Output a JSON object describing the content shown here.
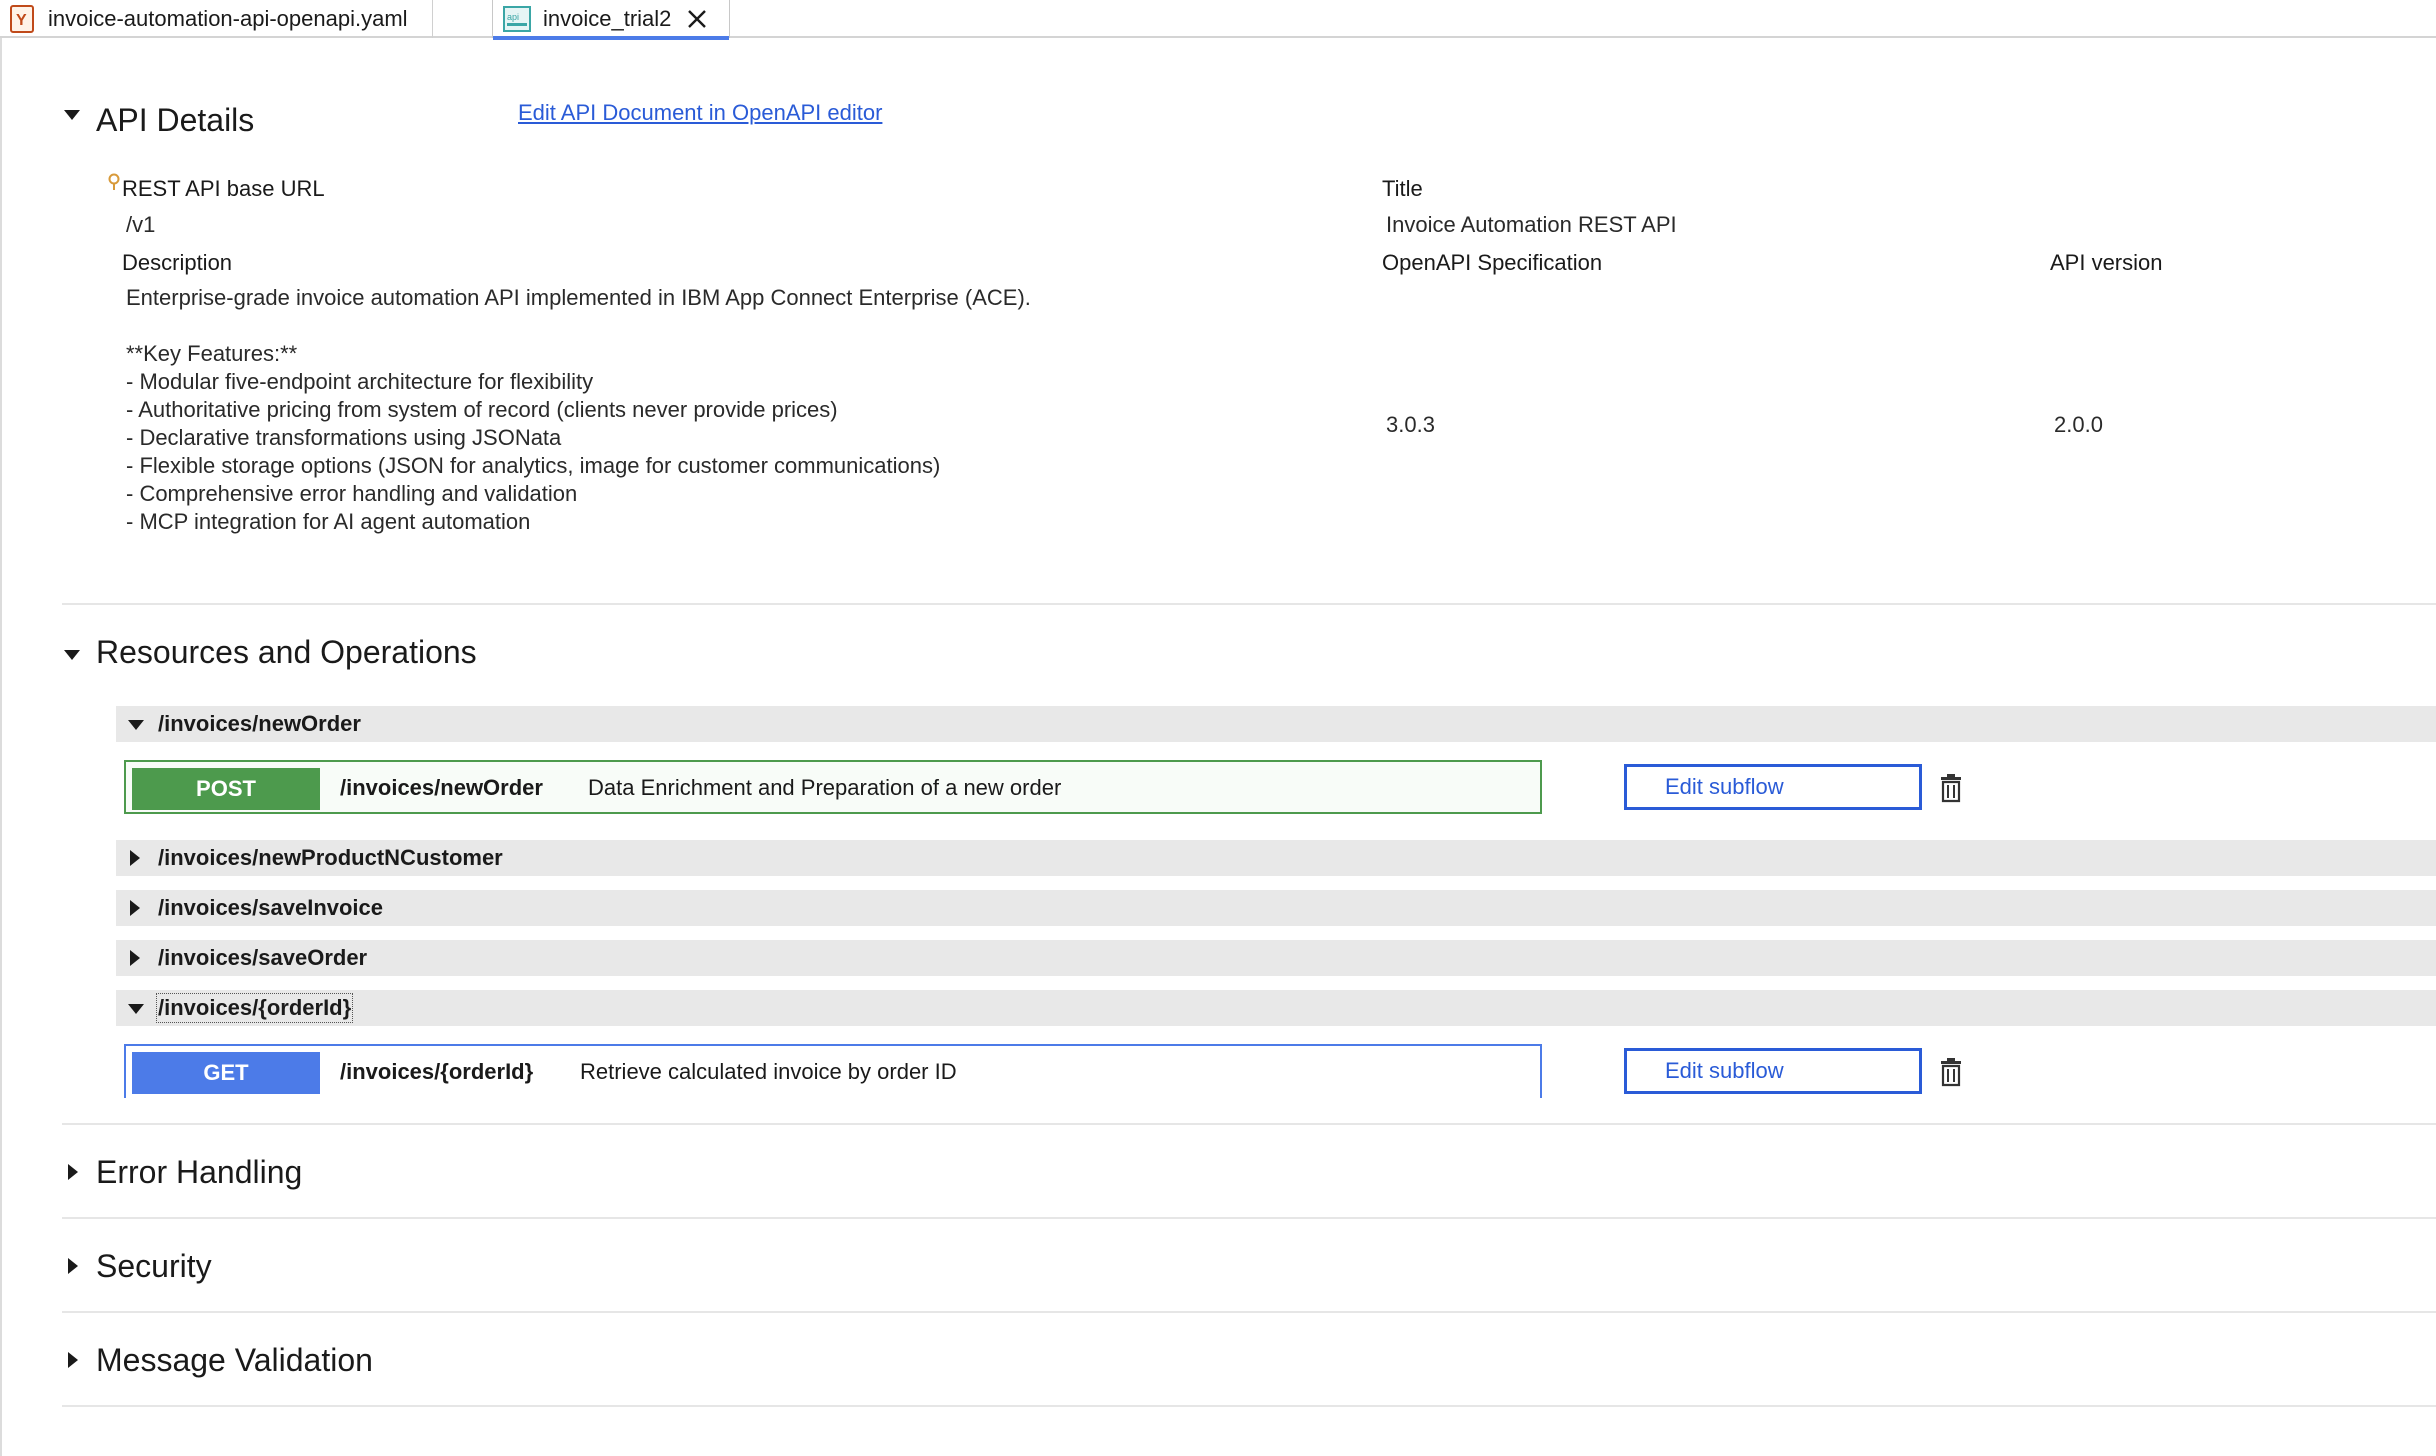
{
  "tabs": [
    {
      "label": "invoice-automation-api-openapi.yaml",
      "icon": "yaml-file-icon"
    },
    {
      "label": "invoice_trial2",
      "icon": "api-file-icon",
      "active": true
    }
  ],
  "api_details": {
    "section_title": "API Details",
    "edit_link": "Edit API Document in OpenAPI editor",
    "base_url_label": "REST API base URL",
    "base_url_value": "/v1",
    "title_label": "Title",
    "title_value": "Invoice Automation REST API",
    "description_label": "Description",
    "description_value": "Enterprise-grade invoice automation API implemented in IBM App Connect Enterprise (ACE).\n\n**Key Features:**\n- Modular five-endpoint architecture for flexibility\n- Authoritative pricing from system of record (clients never provide prices)\n- Declarative transformations using JSONata\n- Flexible storage options (JSON for analytics, image for customer communications)\n- Comprehensive error handling and validation\n- MCP integration for AI agent automation",
    "openapi_label": "OpenAPI Specification",
    "openapi_value": "3.0.3",
    "version_label": "API version",
    "version_value": "2.0.0"
  },
  "resources": {
    "section_title": "Resources and Operations",
    "items": [
      {
        "path": "/invoices/newOrder",
        "expanded": true,
        "operation": {
          "method": "POST",
          "path": "/invoices/newOrder",
          "summary": "Data Enrichment and Preparation of a new order",
          "button": "Edit subflow",
          "color": "#4d9a4d"
        }
      },
      {
        "path": "/invoices/newProductNCustomer",
        "expanded": false
      },
      {
        "path": "/invoices/saveInvoice",
        "expanded": false
      },
      {
        "path": "/invoices/saveOrder",
        "expanded": false
      },
      {
        "path": "/invoices/{orderId}",
        "expanded": true,
        "operation": {
          "method": "GET",
          "path": "/invoices/{orderId}",
          "summary": "Retrieve calculated invoice by order ID",
          "button": "Edit subflow",
          "color": "#4c7be8"
        }
      }
    ]
  },
  "collapsed_sections": [
    {
      "title": "Error Handling"
    },
    {
      "title": "Security"
    },
    {
      "title": "Message Validation"
    }
  ],
  "colors": {
    "accent": "#2a5bd7",
    "post": "#4d9a4d",
    "get": "#4c7be8"
  }
}
